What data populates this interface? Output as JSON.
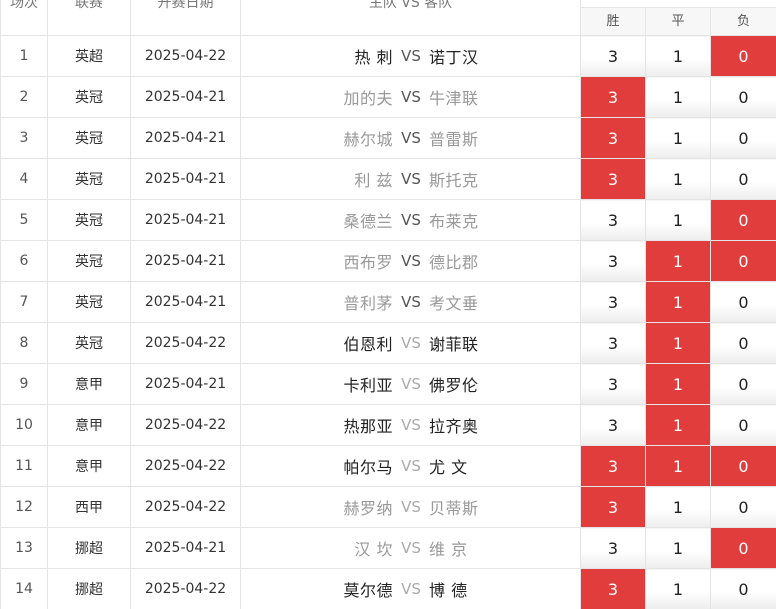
{
  "header": {
    "col_no": "场次",
    "col_league": "联赛",
    "col_date": "开赛日期",
    "col_match": "主队 VS 客队",
    "col_win": "胜",
    "col_draw": "平",
    "col_loss": "负"
  },
  "colors": {
    "highlight": "#e23d3d",
    "text_dark": "#222222",
    "text_gray": "#999999",
    "border": "#e4e4e4"
  },
  "rows": [
    {
      "no": "1",
      "league": "英超",
      "date": "2025-04-22",
      "home": "热 刺",
      "vs": "VS",
      "away": "诺丁汉",
      "home_dim": false,
      "away_dim": false,
      "vs_dim": false,
      "win": "3",
      "draw": "1",
      "loss": "0",
      "hl": [
        false,
        false,
        true
      ]
    },
    {
      "no": "2",
      "league": "英冠",
      "date": "2025-04-21",
      "home": "加的夫",
      "vs": "VS",
      "away": "牛津联",
      "home_dim": true,
      "away_dim": true,
      "vs_dim": false,
      "win": "3",
      "draw": "1",
      "loss": "0",
      "hl": [
        true,
        false,
        false
      ]
    },
    {
      "no": "3",
      "league": "英冠",
      "date": "2025-04-21",
      "home": "赫尔城",
      "vs": "VS",
      "away": "普雷斯",
      "home_dim": true,
      "away_dim": true,
      "vs_dim": false,
      "win": "3",
      "draw": "1",
      "loss": "0",
      "hl": [
        true,
        false,
        false
      ]
    },
    {
      "no": "4",
      "league": "英冠",
      "date": "2025-04-21",
      "home": "利 兹",
      "vs": "VS",
      "away": "斯托克",
      "home_dim": true,
      "away_dim": true,
      "vs_dim": false,
      "win": "3",
      "draw": "1",
      "loss": "0",
      "hl": [
        true,
        false,
        false
      ]
    },
    {
      "no": "5",
      "league": "英冠",
      "date": "2025-04-21",
      "home": "桑德兰",
      "vs": "VS",
      "away": "布莱克",
      "home_dim": true,
      "away_dim": true,
      "vs_dim": false,
      "win": "3",
      "draw": "1",
      "loss": "0",
      "hl": [
        false,
        false,
        true
      ]
    },
    {
      "no": "6",
      "league": "英冠",
      "date": "2025-04-21",
      "home": "西布罗",
      "vs": "VS",
      "away": "德比郡",
      "home_dim": true,
      "away_dim": true,
      "vs_dim": false,
      "win": "3",
      "draw": "1",
      "loss": "0",
      "hl": [
        false,
        true,
        true
      ]
    },
    {
      "no": "7",
      "league": "英冠",
      "date": "2025-04-21",
      "home": "普利茅",
      "vs": "VS",
      "away": "考文垂",
      "home_dim": true,
      "away_dim": true,
      "vs_dim": false,
      "win": "3",
      "draw": "1",
      "loss": "0",
      "hl": [
        false,
        true,
        false
      ]
    },
    {
      "no": "8",
      "league": "英冠",
      "date": "2025-04-22",
      "home": "伯恩利",
      "vs": "VS",
      "away": "谢菲联",
      "home_dim": false,
      "away_dim": false,
      "vs_dim": true,
      "win": "3",
      "draw": "1",
      "loss": "0",
      "hl": [
        false,
        true,
        false
      ]
    },
    {
      "no": "9",
      "league": "意甲",
      "date": "2025-04-21",
      "home": "卡利亚",
      "vs": "VS",
      "away": "佛罗伦",
      "home_dim": false,
      "away_dim": false,
      "vs_dim": true,
      "win": "3",
      "draw": "1",
      "loss": "0",
      "hl": [
        false,
        true,
        false
      ]
    },
    {
      "no": "10",
      "league": "意甲",
      "date": "2025-04-22",
      "home": "热那亚",
      "vs": "VS",
      "away": "拉齐奥",
      "home_dim": false,
      "away_dim": false,
      "vs_dim": true,
      "win": "3",
      "draw": "1",
      "loss": "0",
      "hl": [
        false,
        true,
        false
      ]
    },
    {
      "no": "11",
      "league": "意甲",
      "date": "2025-04-22",
      "home": "帕尔马",
      "vs": "VS",
      "away": "尤 文",
      "home_dim": false,
      "away_dim": false,
      "vs_dim": true,
      "win": "3",
      "draw": "1",
      "loss": "0",
      "hl": [
        true,
        true,
        true
      ]
    },
    {
      "no": "12",
      "league": "西甲",
      "date": "2025-04-22",
      "home": "赫罗纳",
      "vs": "VS",
      "away": "贝蒂斯",
      "home_dim": true,
      "away_dim": true,
      "vs_dim": true,
      "win": "3",
      "draw": "1",
      "loss": "0",
      "hl": [
        true,
        false,
        false
      ]
    },
    {
      "no": "13",
      "league": "挪超",
      "date": "2025-04-21",
      "home": "汉 坎",
      "vs": "VS",
      "away": "维 京",
      "home_dim": true,
      "away_dim": true,
      "vs_dim": true,
      "win": "3",
      "draw": "1",
      "loss": "0",
      "hl": [
        false,
        false,
        true
      ]
    },
    {
      "no": "14",
      "league": "挪超",
      "date": "2025-04-22",
      "home": "莫尔德",
      "vs": "VS",
      "away": "博 德",
      "home_dim": false,
      "away_dim": false,
      "vs_dim": true,
      "win": "3",
      "draw": "1",
      "loss": "0",
      "hl": [
        true,
        false,
        false
      ]
    }
  ]
}
